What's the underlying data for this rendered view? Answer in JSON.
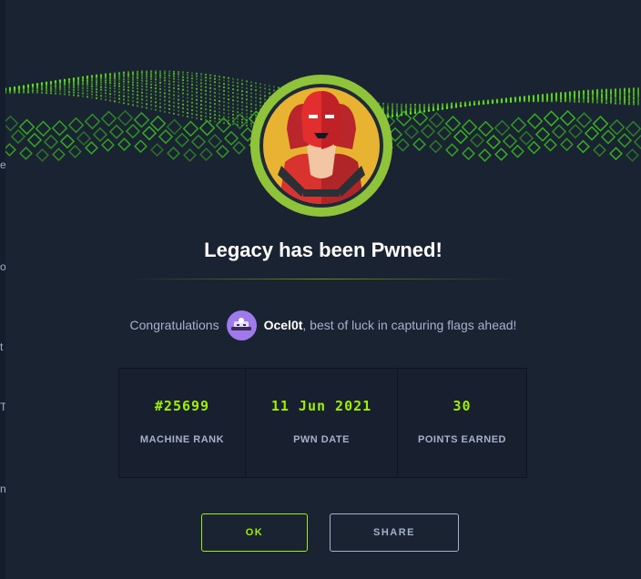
{
  "modal": {
    "title": "Legacy has been Pwned!",
    "avatar_icon": "machine-avatar-icon"
  },
  "congrats": {
    "prefix": "Congratulations",
    "username": "Ocel0t",
    "suffix": ", best of luck in capturing flags ahead!",
    "user_avatar_icon": "user-avatar-icon"
  },
  "stats": [
    {
      "value": "#25699",
      "label": "MACHINE RANK"
    },
    {
      "value": "11 Jun 2021",
      "label": "PWN DATE"
    },
    {
      "value": "30",
      "label": "POINTS EARNED"
    }
  ],
  "buttons": {
    "ok": "OK",
    "share": "SHARE"
  },
  "colors": {
    "accent": "#9fef00",
    "background": "#1a2332",
    "muted_text": "#a4b1cd",
    "user_avatar": "#9f7aea"
  }
}
